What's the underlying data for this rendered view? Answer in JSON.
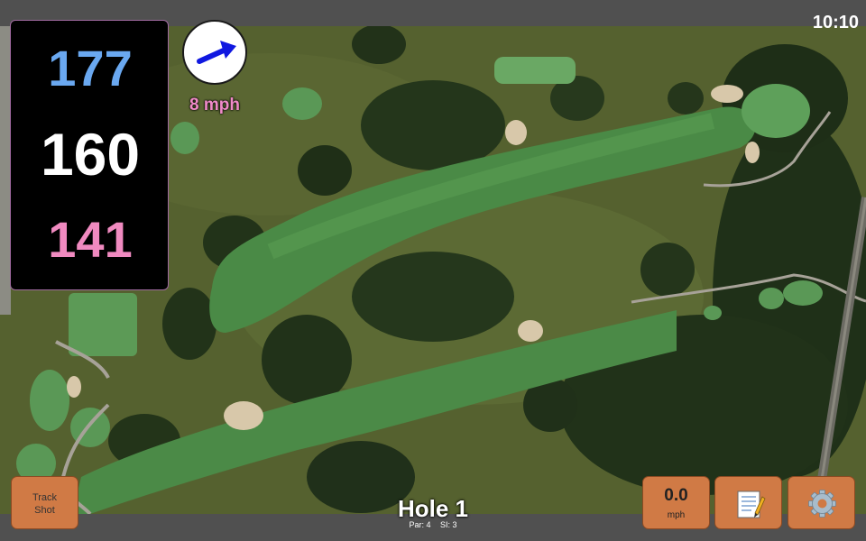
{
  "status_bar": {
    "time": "10:10"
  },
  "distances": {
    "back": "177",
    "center": "160",
    "front": "141"
  },
  "wind": {
    "speed_label": "8 mph",
    "direction_icon": "arrow-icon"
  },
  "track_shot_button": {
    "label_line1": "Track",
    "label_line2": "Shot"
  },
  "speed_button": {
    "value": "0.0",
    "unit": "mph"
  },
  "notes_button": {
    "icon": "notepad-icon"
  },
  "settings_button": {
    "icon": "gear-icon"
  },
  "hole": {
    "title": "Hole 1",
    "par": "Par: 4",
    "si": "SI: 3"
  },
  "colors": {
    "back_distance": "#6aa8f0",
    "center_distance": "#ffffff",
    "front_distance": "#f08ac0",
    "wind_text": "#f08ac8",
    "button": "#d07a45",
    "wind_arrow": "#1018e0"
  }
}
